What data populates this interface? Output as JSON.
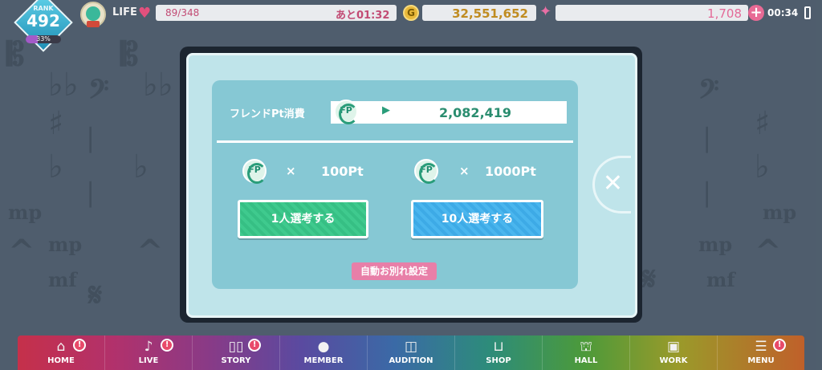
{
  "status": {
    "rank_label": "RANK",
    "rank_value": "492",
    "rank_progress_pct": "33%",
    "rank_progress": 0.33,
    "life_label": "LIFE",
    "life_count": "89/348",
    "life_timer": "あと01:32",
    "coin_icon_text": "G",
    "gold": "32,551,652",
    "gems": "1,708",
    "clock": "00:34",
    "colors": {
      "life": "#c24b74",
      "gold": "#c08c21",
      "gem": "#e46a98"
    }
  },
  "dialog": {
    "pt_label": "フレンドPt消費",
    "pt_value": "2,082,419",
    "times": "×",
    "cost_single": "100Pt",
    "cost_ten": "1000Pt",
    "draw_single": "1人選考する",
    "draw_ten": "10人選考する",
    "auto_farewell": "自動お別れ設定",
    "close": "✕"
  },
  "nav": {
    "items": [
      {
        "label": "HOME",
        "icon": "home-icon",
        "alert": true
      },
      {
        "label": "LIVE",
        "icon": "music-note-icon",
        "alert": true
      },
      {
        "label": "STORY",
        "icon": "book-icon",
        "alert": true
      },
      {
        "label": "MEMBER",
        "icon": "member-icon",
        "alert": false
      },
      {
        "label": "AUDITION",
        "icon": "audition-icon",
        "alert": false
      },
      {
        "label": "SHOP",
        "icon": "basket-icon",
        "alert": false
      },
      {
        "label": "HALL",
        "icon": "hall-icon",
        "alert": false
      },
      {
        "label": "WORK",
        "icon": "work-icon",
        "alert": false
      },
      {
        "label": "MENU",
        "icon": "menu-icon",
        "alert": true
      }
    ],
    "alert_mark": "!"
  }
}
